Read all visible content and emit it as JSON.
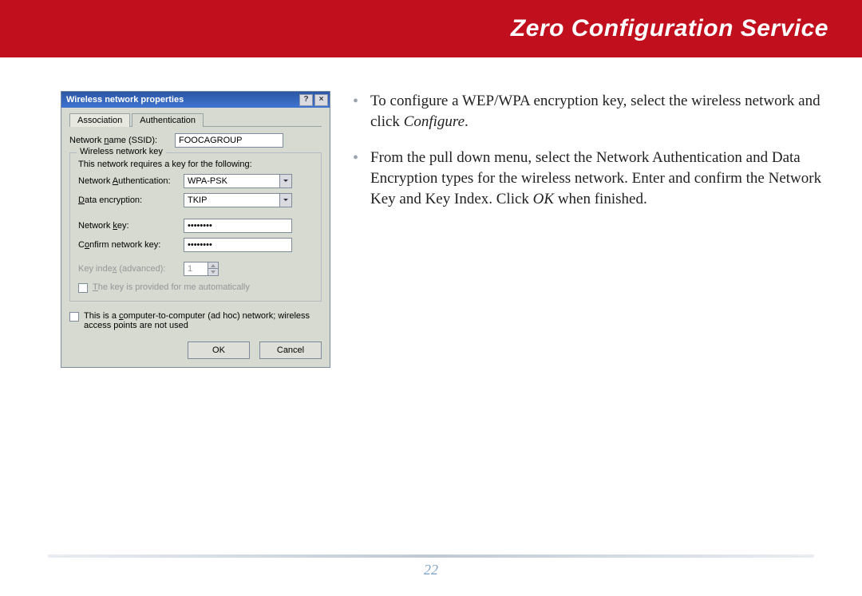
{
  "header": {
    "title": "Zero Configuration Service"
  },
  "page_number": "22",
  "instructions": {
    "b1_a": "To configure a WEP/WPA encryption key, select the wireless network and click ",
    "b1_b": "Configure",
    "b1_c": ".",
    "b2_a": "From the pull down menu, select the Network Authentication and Data Encryption types for the wireless network.  Enter and confirm the Network Key and Key Index.  Click ",
    "b2_b": "OK",
    "b2_c": " when finished."
  },
  "dialog": {
    "title": "Wireless network properties",
    "help_btn": "?",
    "close_btn": "×",
    "tabs": {
      "association": "Association",
      "authentication": "Authentication"
    },
    "ssid_label_a": "Network ",
    "ssid_label_u": "n",
    "ssid_label_b": "ame (SSID):",
    "ssid_value": "FOOCAGROUP",
    "group_title": "Wireless network key",
    "group_note": "This network requires a key for the following:",
    "auth_label_a": "Network ",
    "auth_label_u": "A",
    "auth_label_b": "uthentication:",
    "auth_value": "WPA-PSK",
    "enc_label_u": "D",
    "enc_label_b": "ata encryption:",
    "enc_value": "TKIP",
    "key_label_a": "Network ",
    "key_label_u": "k",
    "key_label_b": "ey:",
    "key_value": "••••••••",
    "confirm_label_a": "C",
    "confirm_label_u": "o",
    "confirm_label_b": "nfirm network key:",
    "confirm_value": "••••••••",
    "keyindex_label_a": "Key inde",
    "keyindex_label_u": "x",
    "keyindex_label_b": " (advanced):",
    "keyindex_value": "1",
    "provided_label_u": "T",
    "provided_label_b": "he key is provided for me automatically",
    "adhoc_label_a": "This is a ",
    "adhoc_label_u": "c",
    "adhoc_label_b": "omputer-to-computer (ad hoc) network; wireless access points are not used",
    "ok": "OK",
    "cancel": "Cancel"
  }
}
